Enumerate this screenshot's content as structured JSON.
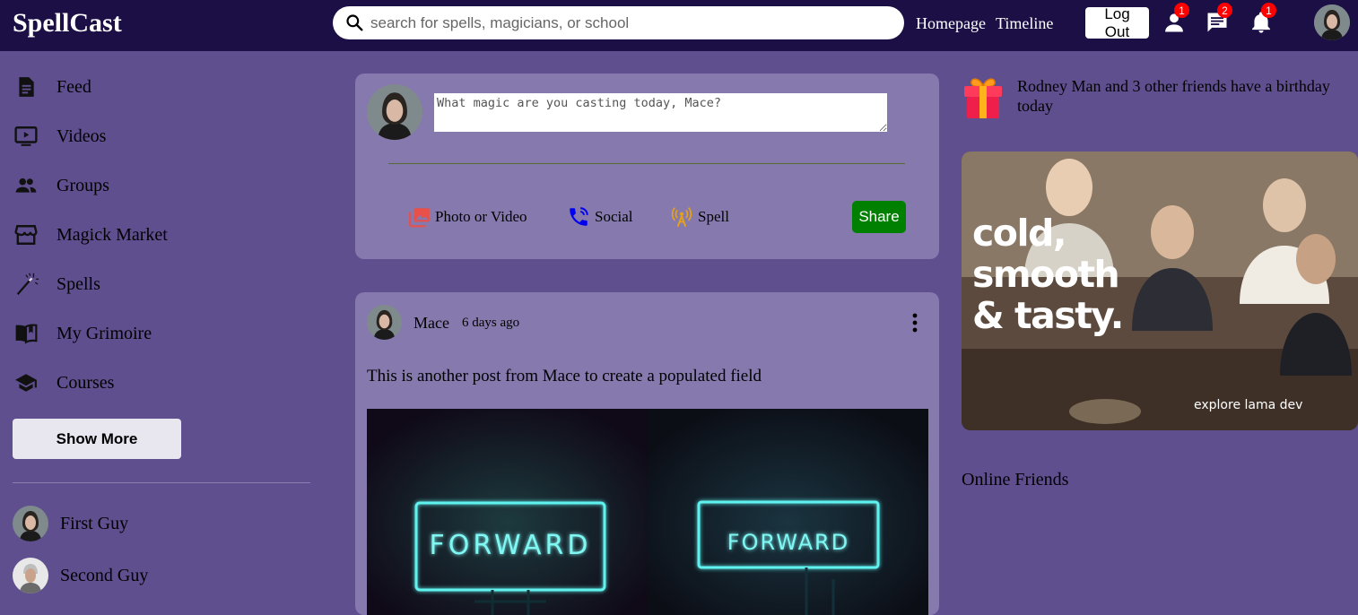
{
  "app": {
    "title": "SpellCast"
  },
  "search": {
    "placeholder": "search for spells, magicians, or school"
  },
  "nav": {
    "homepage": "Homepage",
    "timeline": "Timeline",
    "logout": "Log Out",
    "friend_requests_count": "1",
    "messages_count": "2",
    "notifications_count": "1"
  },
  "sidebar": {
    "items": [
      {
        "label": "Feed",
        "icon": "feed-icon"
      },
      {
        "label": "Videos",
        "icon": "video-icon"
      },
      {
        "label": "Groups",
        "icon": "groups-icon"
      },
      {
        "label": "Magick Market",
        "icon": "store-icon"
      },
      {
        "label": "Spells",
        "icon": "magic-wand-icon"
      },
      {
        "label": "My Grimoire",
        "icon": "book-icon"
      },
      {
        "label": "Courses",
        "icon": "school-icon"
      }
    ],
    "show_more": "Show More",
    "friends": [
      {
        "name": "First Guy"
      },
      {
        "name": "Second Guy"
      }
    ]
  },
  "share": {
    "placeholder": "What magic are you casting today, Mace?",
    "options": [
      {
        "label": "Photo or Video",
        "icon": "photo-library-icon",
        "color": "#e8504a"
      },
      {
        "label": "Social",
        "icon": "phone-call-icon",
        "color": "#0000ee"
      },
      {
        "label": "Spell",
        "icon": "broadcast-icon",
        "color": "#e3a21a"
      }
    ],
    "button": "Share",
    "button_color": "#008000"
  },
  "post": {
    "user": "Mace",
    "date": "6 days ago",
    "text": "This is another post from Mace to create a populated field",
    "image_text_left": "FORWARD",
    "image_text_right": "FORWARD"
  },
  "rightbar": {
    "birthday_text": "Rodney Man and 3 other friends have a birthday today",
    "ad_headline": "cold,\nsmooth\n& tasty.",
    "ad_caption": "explore lama dev",
    "online_title": "Online Friends"
  },
  "colors": {
    "topbar": "#1c0f45",
    "background": "#5f4f8f",
    "card": "#8679ad",
    "badge": "#ff0000"
  }
}
